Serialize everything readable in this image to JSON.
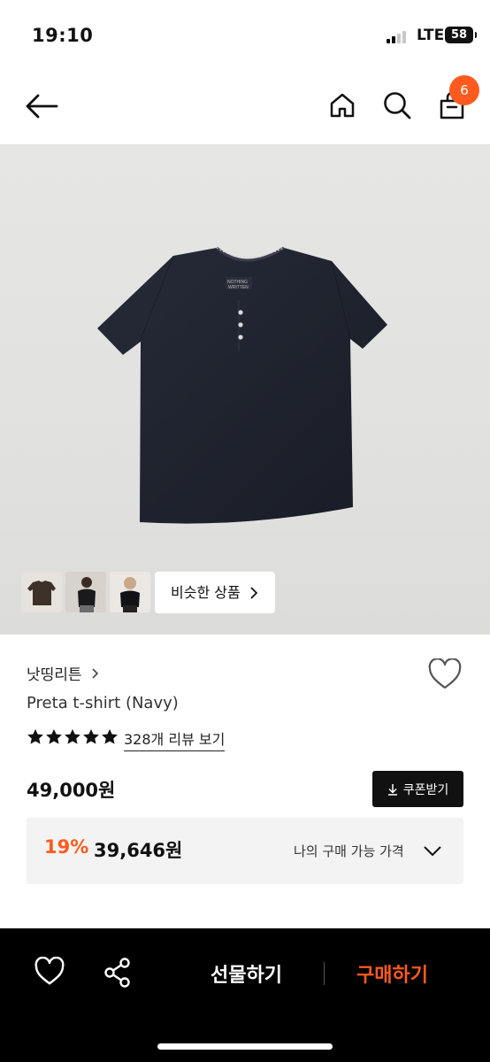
{
  "status_bar": {
    "time": "19:10",
    "network": "LTE",
    "battery": "58"
  },
  "nav": {
    "cart_count": "6"
  },
  "gallery": {
    "similar_label": "비슷한 상품"
  },
  "product": {
    "brand": "낫띵리튼",
    "name": "Preta t-shirt (Navy)",
    "rating_stars": 5,
    "review_label": "328개 리뷰 보기",
    "price": "49,000원",
    "coupon_label": "쿠폰받기",
    "discount_rate": "19%",
    "discounted_price": "39,646원",
    "my_price_label": "나의 구매 가능 가격"
  },
  "bottom_bar": {
    "gift_label": "선물하기",
    "buy_label": "구매하기"
  },
  "colors": {
    "accent": "#ff5a1f",
    "dark": "#111111"
  },
  "icons": [
    "back-arrow-icon",
    "home-icon",
    "search-icon",
    "shopping-bag-icon",
    "chevron-right-icon",
    "heart-icon",
    "star-icon",
    "download-icon",
    "chevron-down-icon",
    "share-icon"
  ]
}
